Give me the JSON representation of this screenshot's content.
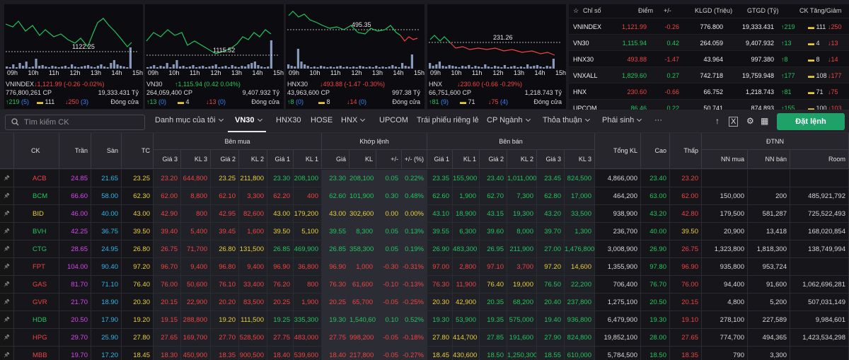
{
  "minis": [
    {
      "hours": [
        "09h",
        "10h",
        "11h",
        "12h",
        "13h",
        "14h",
        "15h"
      ],
      "level": "1122.25",
      "name": "VNINDEX",
      "change": "↓1,121.99 (-0.26 -0.02%)",
      "dir": "dn",
      "vol": "776,800,261 CP",
      "val": "19,333.431 Tỷ",
      "up": "↑219",
      "up_c": "(5)",
      "eq": "111",
      "down": "↓250",
      "down_c": "(3)",
      "status": "Đóng cửa"
    },
    {
      "hours": [
        "09h",
        "10h",
        "11h",
        "12h",
        "13h",
        "14h",
        "15h"
      ],
      "level": "1115.52",
      "name": "VN30",
      "change": "↑1,115.94 (0.42 0.04%)",
      "dir": "up",
      "vol": "264,059,400 CP",
      "val": "9,407.932 Tỷ",
      "up": "↑13",
      "up_c": "(0)",
      "eq": "4",
      "down": "↓13",
      "down_c": "(0)",
      "status": "Đóng cửa"
    },
    {
      "hours": [
        "09h",
        "10h",
        "11h",
        "12h",
        "13h",
        "14h",
        "15h"
      ],
      "level": "495.35",
      "name": "HNX30",
      "change": "↓493.88 (-1.47 -0.30%)",
      "dir": "dn",
      "vol": "43,963,600 CP",
      "val": "997.38 Tỷ",
      "up": "↑8",
      "up_c": "(0)",
      "eq": "8",
      "down": "↓14",
      "down_c": "(0)",
      "status": "Đóng cửa"
    },
    {
      "hours": [
        "09h",
        "10h",
        "11h",
        "12h",
        "13h",
        "14h",
        "15h"
      ],
      "level": "231.26",
      "name": "HNX",
      "change": "↓230.60 (-0.66 -0.29%)",
      "dir": "dn",
      "vol": "66,751,600 CP",
      "val": "1,218.743 Tỷ",
      "up": "↑81",
      "up_c": "(9)",
      "eq": "71",
      "down": "↓75",
      "down_c": "(4)",
      "status": "Đóng cửa"
    }
  ],
  "indices": {
    "headers": {
      "name": "Chỉ số",
      "point": "Điểm",
      "change": "+/-",
      "kl": "KLGD (Triệu)",
      "gt": "GTGD (Tỷ)",
      "ud": "CK Tăng/Giảm"
    },
    "rows": [
      {
        "name": "VNINDEX",
        "point": "1,121.99",
        "change": "-0.26",
        "kl": "776.800",
        "gt": "19,333.431",
        "up": "↑219",
        "eq": "111",
        "down": "↓250",
        "dir": "dn"
      },
      {
        "name": "VN30",
        "point": "1,115.94",
        "change": "0.42",
        "kl": "264.059",
        "gt": "9,407.932",
        "up": "↑13",
        "eq": "4",
        "down": "↓13",
        "dir": "up"
      },
      {
        "name": "HNX30",
        "point": "493.88",
        "change": "-1.47",
        "kl": "43.964",
        "gt": "997.380",
        "up": "↑8",
        "eq": "8",
        "down": "↓14",
        "dir": "dn"
      },
      {
        "name": "VNXALL",
        "point": "1,829.60",
        "change": "0.27",
        "kl": "742.718",
        "gt": "19,759.948",
        "up": "↑177",
        "eq": "108",
        "down": "↓177",
        "dir": "up"
      },
      {
        "name": "HNX",
        "point": "230.60",
        "change": "-0.66",
        "kl": "66.752",
        "gt": "1,218.743",
        "up": "↑81",
        "eq": "71",
        "down": "↓75",
        "dir": "dn"
      },
      {
        "name": "UPCOM",
        "point": "86.46",
        "change": "0.22",
        "kl": "50.741",
        "gt": "874.893",
        "up": "↑155",
        "eq": "100",
        "down": "↓103",
        "dir": "up"
      }
    ]
  },
  "toolbar": {
    "search_placeholder": "Tìm kiếm CK",
    "tabs": [
      "Danh mục của tôi",
      "VN30",
      "HNX30",
      "HOSE",
      "HNX",
      "UPCOM",
      "Trái phiếu riêng lẻ",
      "CP Ngành",
      "Thỏa thuận",
      "Phái sinh",
      "···"
    ],
    "order_label": "Đặt lệnh"
  },
  "table": {
    "groups": {
      "buy": "Bên mua",
      "match": "Khớp lệnh",
      "sell": "Bên bán",
      "foreign": "ĐTNN"
    },
    "cols": {
      "ck": "CK",
      "ceil": "Trần",
      "floor": "Sàn",
      "ref": "TC",
      "p3": "Giá 3",
      "v3": "KL 3",
      "p2": "Giá 2",
      "v2": "KL 2",
      "p1": "Giá 1",
      "v1": "KL 1",
      "mp": "Giá",
      "mv": "KL",
      "chg": "+/-",
      "pct": "+/- (%)",
      "sp1": "Giá 1",
      "sv1": "KL 1",
      "sp2": "Giá 2",
      "sv2": "KL 2",
      "sp3": "Giá 3",
      "sv3": "KL 3",
      "total": "Tổng KL",
      "high": "Cao",
      "low": "Thấp",
      "fbuy": "NN mua",
      "fsell": "NN bán",
      "room": "Room"
    },
    "rows": [
      {
        "sym": "ACB",
        "c": "dn",
        "ceil": "24.85",
        "floor": "21.65",
        "ref": "23.25",
        "b3": [
          "23.20",
          "644,800",
          "dn"
        ],
        "b2": [
          "23.25",
          "211,800",
          "ref"
        ],
        "b1": [
          "23.30",
          "208,100",
          "up"
        ],
        "m": [
          "23.30",
          "208,100",
          "0.05",
          "0.22%",
          "up"
        ],
        "s1": [
          "23.35",
          "155,900",
          "up"
        ],
        "s2": [
          "23.40",
          "1,011,000",
          "up"
        ],
        "s3": [
          "23.45",
          "824,500",
          "up"
        ],
        "total": "4,866,000",
        "high": [
          "23.40",
          "up"
        ],
        "low": [
          "23.20",
          "dn"
        ],
        "fb": "",
        "fs": "",
        "room": ""
      },
      {
        "sym": "BCM",
        "c": "up",
        "ceil": "66.60",
        "floor": "58.00",
        "ref": "62.30",
        "b3": [
          "62.00",
          "8,800",
          "dn"
        ],
        "b2": [
          "62.10",
          "3,300",
          "dn"
        ],
        "b1": [
          "62.20",
          "400",
          "dn"
        ],
        "m": [
          "62.60",
          "101,900",
          "0.30",
          "0.48%",
          "up"
        ],
        "s1": [
          "62.60",
          "1,900",
          "up"
        ],
        "s2": [
          "62.70",
          "7,300",
          "up"
        ],
        "s3": [
          "62.80",
          "17,000",
          "up"
        ],
        "total": "464,200",
        "high": [
          "63.00",
          "up"
        ],
        "low": [
          "62.00",
          "dn"
        ],
        "fb": "150,000",
        "fs": "200",
        "room": "485,921,792"
      },
      {
        "sym": "BID",
        "c": "ref",
        "ceil": "46.00",
        "floor": "40.00",
        "ref": "43.00",
        "b3": [
          "42.90",
          "800",
          "dn"
        ],
        "b2": [
          "42.95",
          "82,600",
          "dn"
        ],
        "b1": [
          "43.00",
          "179,200",
          "ref"
        ],
        "m": [
          "43.00",
          "302,600",
          "0.00",
          "0.00%",
          "ref"
        ],
        "s1": [
          "43.10",
          "18,900",
          "up"
        ],
        "s2": [
          "43.15",
          "19,300",
          "up"
        ],
        "s3": [
          "43.20",
          "33,500",
          "up"
        ],
        "total": "938,900",
        "high": [
          "43.20",
          "up"
        ],
        "low": [
          "42.80",
          "dn"
        ],
        "fb": "179,500",
        "fs": "581,287",
        "room": "725,522,493"
      },
      {
        "sym": "BVH",
        "c": "up",
        "ceil": "42.25",
        "floor": "36.75",
        "ref": "39.50",
        "b3": [
          "39.40",
          "5,400",
          "dn"
        ],
        "b2": [
          "39.45",
          "1,600",
          "dn"
        ],
        "b1": [
          "39.50",
          "5,100",
          "ref"
        ],
        "m": [
          "39.55",
          "8,300",
          "0.05",
          "0.13%",
          "up"
        ],
        "s1": [
          "39.55",
          "6,300",
          "up"
        ],
        "s2": [
          "39.60",
          "8,000",
          "up"
        ],
        "s3": [
          "39.70",
          "1,300",
          "up"
        ],
        "total": "236,700",
        "high": [
          "40.00",
          "up"
        ],
        "low": [
          "39.50",
          "ref"
        ],
        "fb": "20,900",
        "fs": "13,418",
        "room": "168,020,854"
      },
      {
        "sym": "CTG",
        "c": "up",
        "ceil": "28.65",
        "floor": "24.95",
        "ref": "26.80",
        "b3": [
          "26.75",
          "71,700",
          "dn"
        ],
        "b2": [
          "26.80",
          "131,500",
          "ref"
        ],
        "b1": [
          "26.85",
          "469,900",
          "up"
        ],
        "m": [
          "26.85",
          "358,300",
          "0.05",
          "0.19%",
          "up"
        ],
        "s1": [
          "26.90",
          "483,300",
          "up"
        ],
        "s2": [
          "26.95",
          "211,900",
          "up"
        ],
        "s3": [
          "27.00",
          "1,476,800",
          "up"
        ],
        "total": "3,008,900",
        "high": [
          "26.90",
          "up"
        ],
        "low": [
          "26.75",
          "dn"
        ],
        "fb": "1,323,800",
        "fs": "1,818,300",
        "room": "138,749,994"
      },
      {
        "sym": "FPT",
        "c": "dn",
        "ceil": "104.00",
        "floor": "90.40",
        "ref": "97.20",
        "b3": [
          "96.70",
          "9,400",
          "dn"
        ],
        "b2": [
          "96.80",
          "9,400",
          "dn"
        ],
        "b1": [
          "96.90",
          "36,800",
          "dn"
        ],
        "m": [
          "96.90",
          "1,000",
          "-0.30",
          "-0.31%",
          "dn"
        ],
        "s1": [
          "97.00",
          "2,800",
          "dn"
        ],
        "s2": [
          "97.10",
          "3,700",
          "dn"
        ],
        "s3": [
          "97.20",
          "14,600",
          "ref"
        ],
        "total": "1,355,900",
        "high": [
          "97.80",
          "up"
        ],
        "low": [
          "96.90",
          "dn"
        ],
        "fb": "935,800",
        "fs": "953,724",
        "room": ""
      },
      {
        "sym": "GAS",
        "c": "dn",
        "ceil": "81.70",
        "floor": "71.10",
        "ref": "76.40",
        "b3": [
          "76.00",
          "50,600",
          "dn"
        ],
        "b2": [
          "76.10",
          "33,400",
          "dn"
        ],
        "b1": [
          "76.20",
          "800",
          "dn"
        ],
        "m": [
          "76.30",
          "61,600",
          "-0.10",
          "-0.13%",
          "dn"
        ],
        "s1": [
          "76.30",
          "11,900",
          "dn"
        ],
        "s2": [
          "76.40",
          "19,000",
          "ref"
        ],
        "s3": [
          "76.50",
          "22,200",
          "up"
        ],
        "total": "706,400",
        "high": [
          "76.70",
          "up"
        ],
        "low": [
          "76.00",
          "dn"
        ],
        "fb": "94,400",
        "fs": "91,600",
        "room": "1,062,696,281"
      },
      {
        "sym": "GVR",
        "c": "dn",
        "ceil": "21.70",
        "floor": "18.90",
        "ref": "20.30",
        "b3": [
          "20.15",
          "22,900",
          "dn"
        ],
        "b2": [
          "20.20",
          "83,500",
          "dn"
        ],
        "b1": [
          "20.25",
          "1,900",
          "dn"
        ],
        "m": [
          "20.25",
          "65,700",
          "-0.05",
          "-0.25%",
          "dn"
        ],
        "s1": [
          "20.30",
          "42,900",
          "ref"
        ],
        "s2": [
          "20.35",
          "68,200",
          "up"
        ],
        "s3": [
          "20.40",
          "237,800",
          "up"
        ],
        "total": "1,275,100",
        "high": [
          "20.50",
          "up"
        ],
        "low": [
          "20.15",
          "dn"
        ],
        "fb": "4,800",
        "fs": "5,200",
        "room": "507,031,149"
      },
      {
        "sym": "HDB",
        "c": "up",
        "ceil": "20.50",
        "floor": "17.90",
        "ref": "19.20",
        "b3": [
          "19.15",
          "288,800",
          "dn"
        ],
        "b2": [
          "19.20",
          "111,500",
          "ref"
        ],
        "b1": [
          "19.25",
          "335,300",
          "up"
        ],
        "m": [
          "19.30",
          "1,540,600",
          "0.10",
          "0.52%",
          "up"
        ],
        "s1": [
          "19.30",
          "53,900",
          "up"
        ],
        "s2": [
          "19.35",
          "575,000",
          "up"
        ],
        "s3": [
          "19.40",
          "936,800",
          "up"
        ],
        "total": "6,479,900",
        "high": [
          "19.30",
          "up"
        ],
        "low": [
          "19.10",
          "dn"
        ],
        "fb": "278,100",
        "fs": "227,589",
        "room": "9,984,601"
      },
      {
        "sym": "HPG",
        "c": "dn",
        "ceil": "29.70",
        "floor": "25.90",
        "ref": "27.80",
        "b3": [
          "27.65",
          "169,700",
          "dn"
        ],
        "b2": [
          "27.70",
          "528,500",
          "dn"
        ],
        "b1": [
          "27.75",
          "483,000",
          "dn"
        ],
        "m": [
          "27.75",
          "998,200",
          "-0.05",
          "-0.18%",
          "dn"
        ],
        "s1": [
          "27.80",
          "414,700",
          "ref"
        ],
        "s2": [
          "27.85",
          "191,600",
          "up"
        ],
        "s3": [
          "27.90",
          "824,800",
          "up"
        ],
        "total": "19,852,100",
        "high": [
          "28.00",
          "up"
        ],
        "low": [
          "27.65",
          "dn"
        ],
        "fb": "774,700",
        "fs": "494,365",
        "room": "1,423,534,298"
      },
      {
        "sym": "MBB",
        "c": "dn",
        "ceil": "19.70",
        "floor": "17.20",
        "ref": "18.45",
        "b3": [
          "18.30",
          "450,900",
          "dn"
        ],
        "b2": [
          "18.35",
          "900,500",
          "dn"
        ],
        "b1": [
          "18.40",
          "539,600",
          "dn"
        ],
        "m": [
          "18.40",
          "217,800",
          "-0.05",
          "-0.27%",
          "dn"
        ],
        "s1": [
          "18.45",
          "430,600",
          "ref"
        ],
        "s2": [
          "18.50",
          "1,250,300",
          "up"
        ],
        "s3": [
          "18.55",
          "610,000",
          "up"
        ],
        "total": "5,784,500",
        "high": [
          "18.50",
          "up"
        ],
        "low": [
          "18.35",
          "dn"
        ],
        "fb": "790",
        "fs": "3,300",
        "room": ""
      }
    ]
  }
}
